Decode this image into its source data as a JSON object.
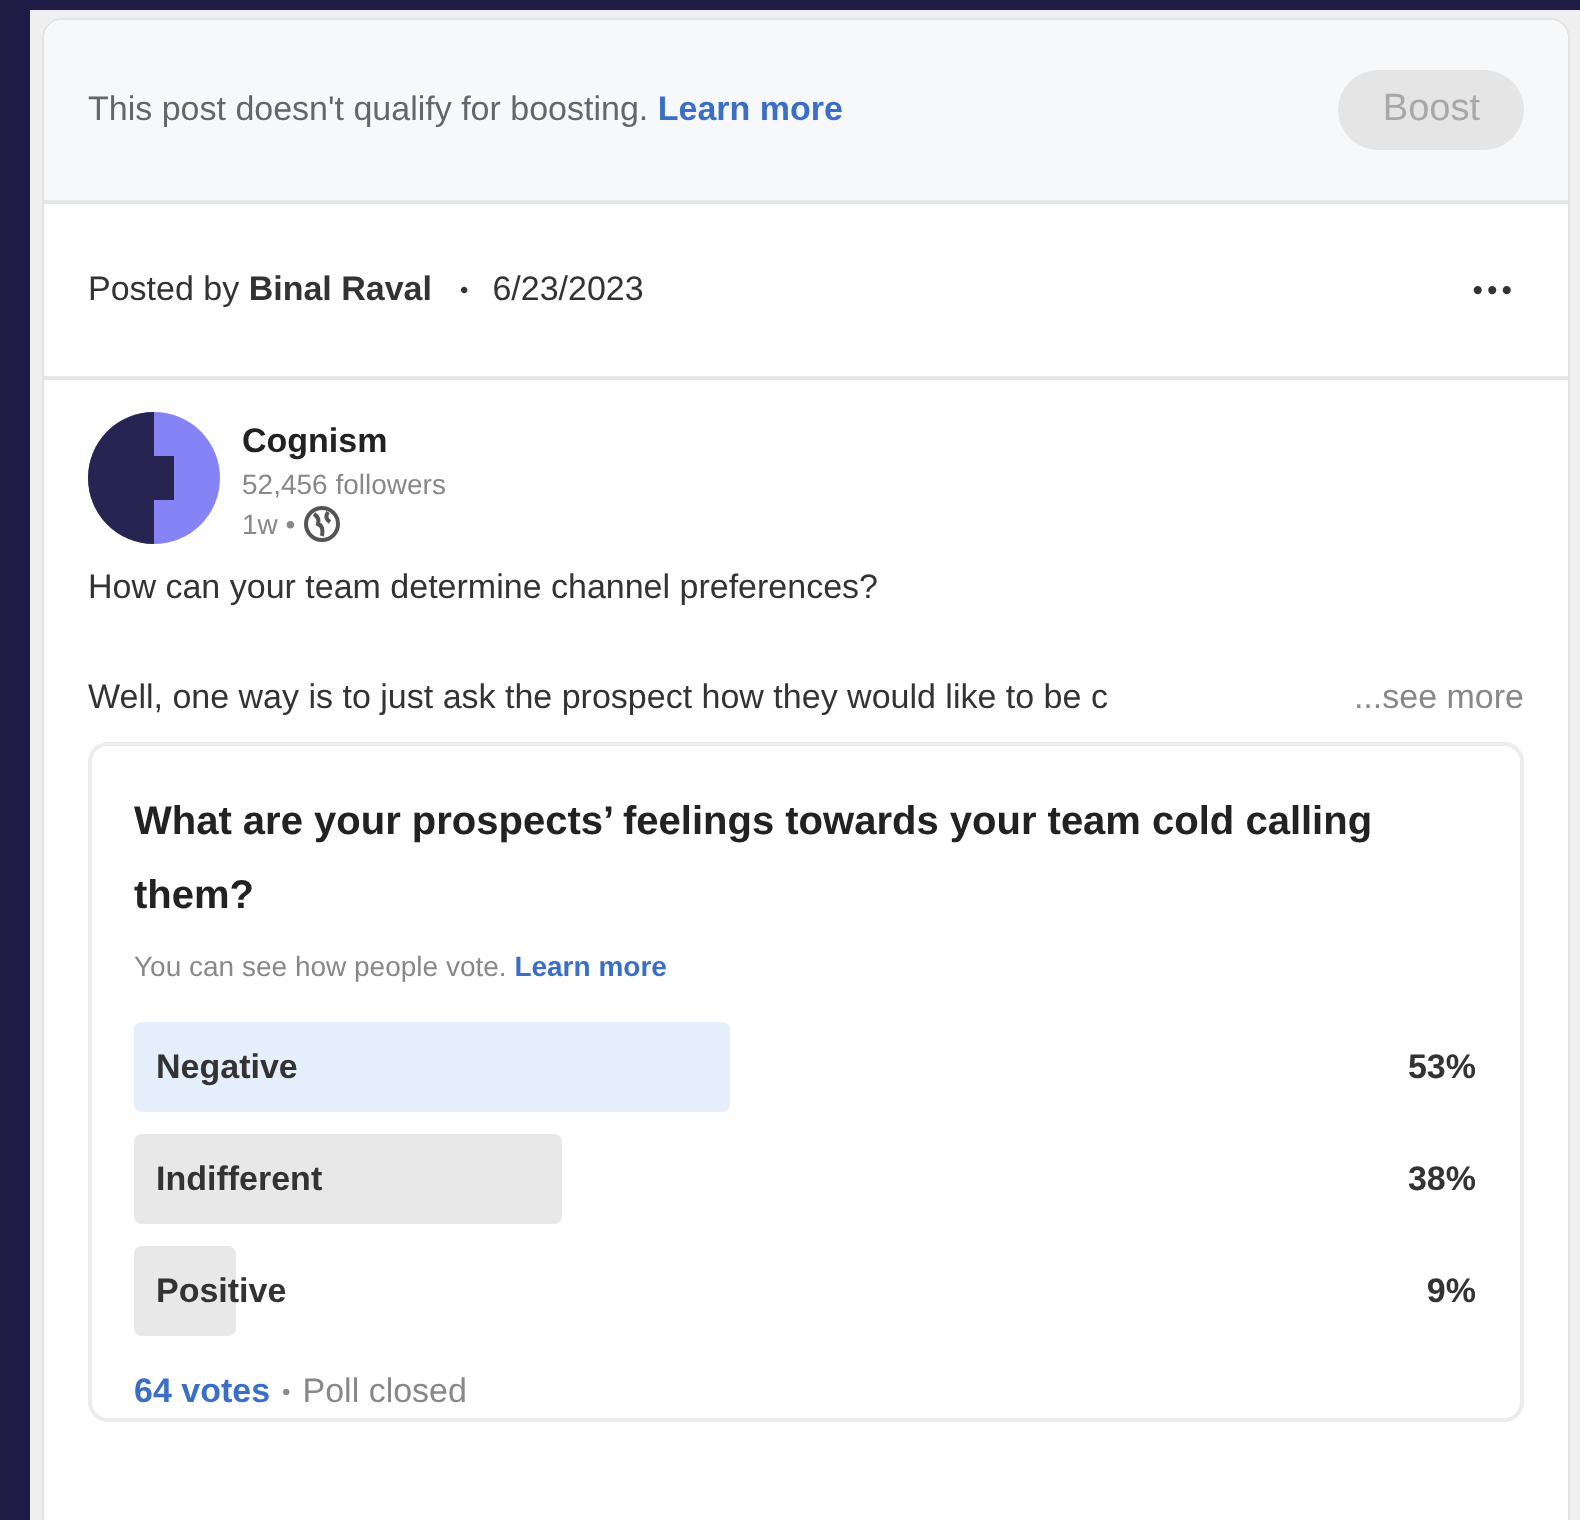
{
  "banner": {
    "message": "This post doesn't qualify for boosting.",
    "link": "Learn more",
    "button": {
      "label": "Boost",
      "disabled": true
    }
  },
  "post_meta": {
    "prefix": "Posted by",
    "author": "Binal Raval",
    "separator": "•",
    "date": "6/23/2023",
    "menu": "•••"
  },
  "author": {
    "name": "Cognism",
    "followers": "52,456 followers",
    "age": "1w •"
  },
  "text": {
    "line_1": "How can your team determine channel preferences?",
    "line_2": "Well, one way is to just ask the prospect how they would like to be c",
    "see_more": "...see more"
  },
  "poll": {
    "question": "What are your prospects’ feelings towards your team cold calling them?",
    "visibility": "You can see how people vote.",
    "link": "Learn more",
    "options": [
      {
        "label": "Negative",
        "percent": "53%",
        "selected": true
      },
      {
        "label": "Indifferent",
        "percent": "38%",
        "selected": false
      },
      {
        "label": "Positive",
        "percent": "9%",
        "selected": false
      }
    ],
    "votes": "64 votes",
    "separator": "•",
    "status": "Poll closed"
  }
}
